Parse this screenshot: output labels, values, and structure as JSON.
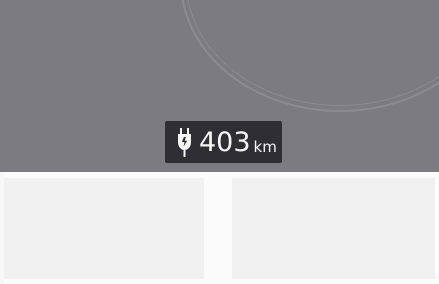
{
  "range_indicator": {
    "value": "403",
    "unit": "km",
    "icon": "charging-plug-icon"
  },
  "colors": {
    "map_background": "#7b7b80",
    "badge_background": "#2f2f33",
    "badge_text": "#f5f5f5",
    "bottom_background": "#fbfbfb"
  }
}
